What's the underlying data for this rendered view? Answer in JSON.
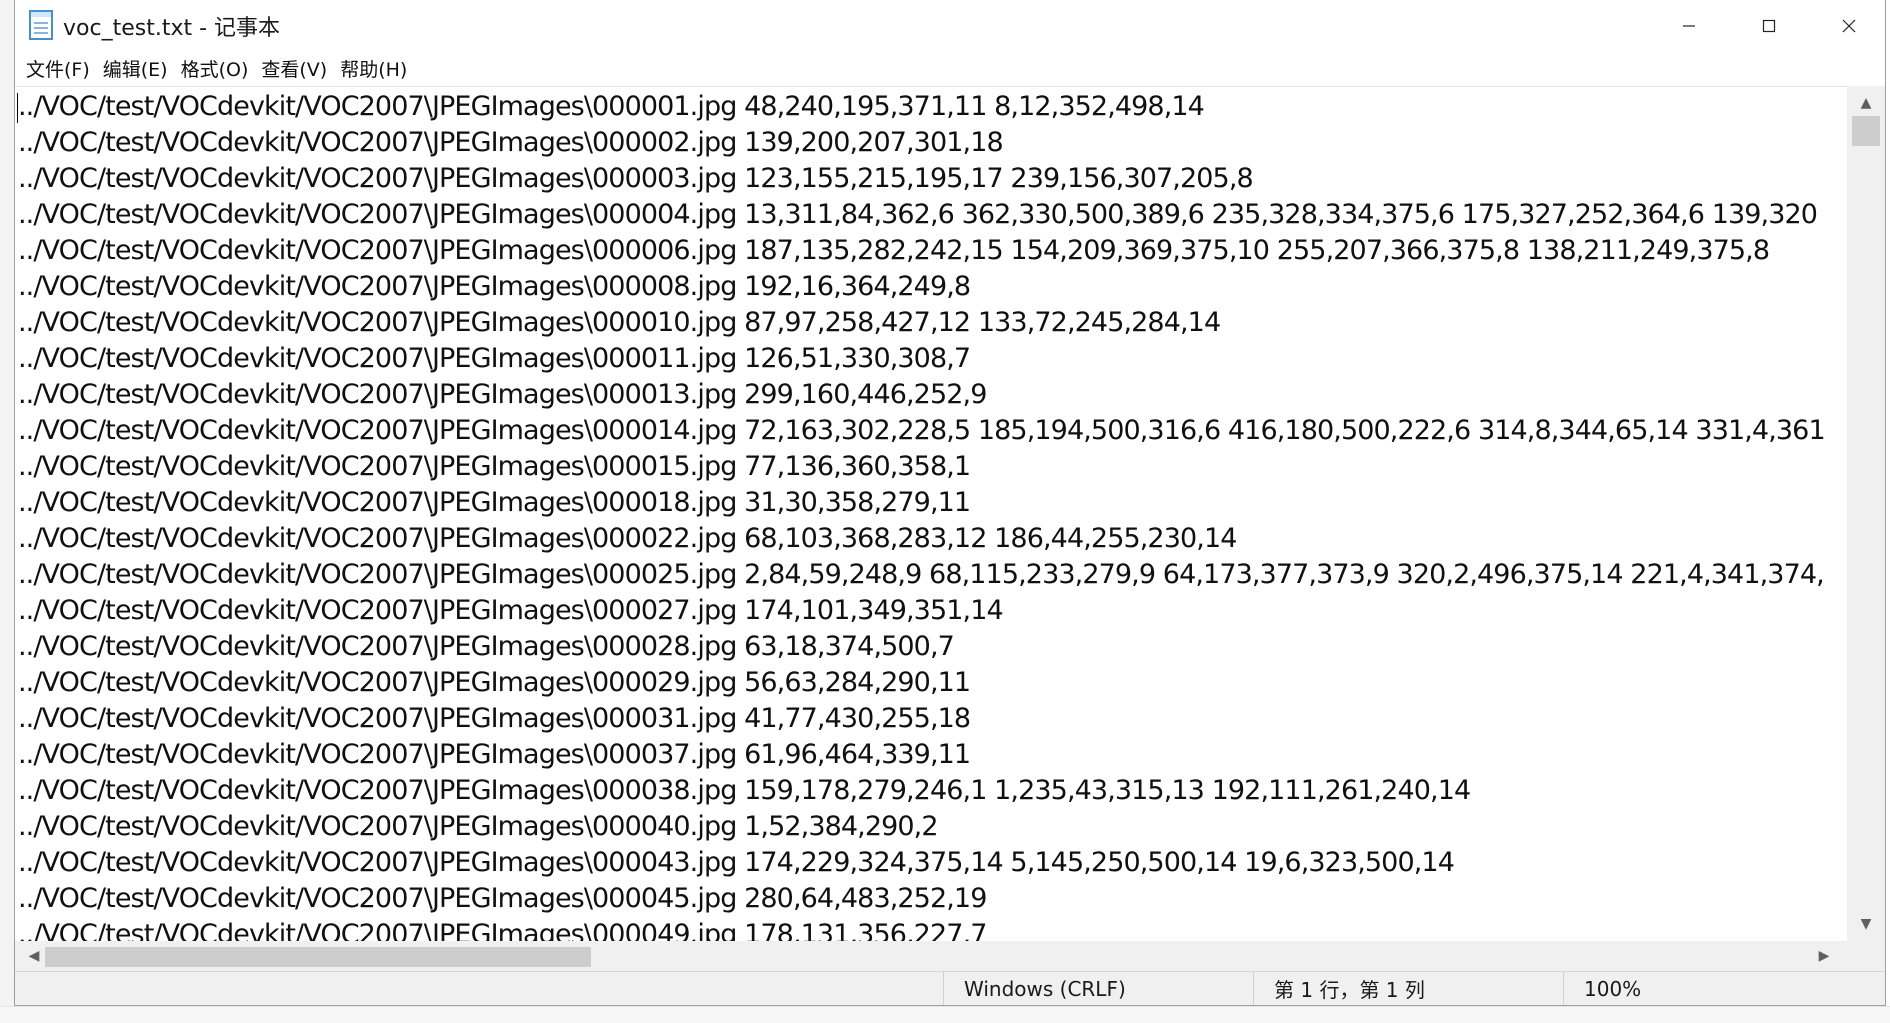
{
  "window": {
    "title": "voc_test.txt - 记事本",
    "controls": {
      "minimize": "minimize-icon",
      "maximize": "maximize-icon",
      "close": "close-icon"
    }
  },
  "menu": {
    "items": [
      {
        "label": "文件(F)"
      },
      {
        "label": "编辑(E)"
      },
      {
        "label": "格式(O)"
      },
      {
        "label": "查看(V)"
      },
      {
        "label": "帮助(H)"
      }
    ]
  },
  "editor": {
    "lines": [
      "../VOC/test/VOCdevkit/VOC2007\\JPEGImages\\000001.jpg 48,240,195,371,11 8,12,352,498,14",
      "../VOC/test/VOCdevkit/VOC2007\\JPEGImages\\000002.jpg 139,200,207,301,18",
      "../VOC/test/VOCdevkit/VOC2007\\JPEGImages\\000003.jpg 123,155,215,195,17 239,156,307,205,8",
      "../VOC/test/VOCdevkit/VOC2007\\JPEGImages\\000004.jpg 13,311,84,362,6 362,330,500,389,6 235,328,334,375,6 175,327,252,364,6 139,320",
      "../VOC/test/VOCdevkit/VOC2007\\JPEGImages\\000006.jpg 187,135,282,242,15 154,209,369,375,10 255,207,366,375,8 138,211,249,375,8",
      "../VOC/test/VOCdevkit/VOC2007\\JPEGImages\\000008.jpg 192,16,364,249,8",
      "../VOC/test/VOCdevkit/VOC2007\\JPEGImages\\000010.jpg 87,97,258,427,12 133,72,245,284,14",
      "../VOC/test/VOCdevkit/VOC2007\\JPEGImages\\000011.jpg 126,51,330,308,7",
      "../VOC/test/VOCdevkit/VOC2007\\JPEGImages\\000013.jpg 299,160,446,252,9",
      "../VOC/test/VOCdevkit/VOC2007\\JPEGImages\\000014.jpg 72,163,302,228,5 185,194,500,316,6 416,180,500,222,6 314,8,344,65,14 331,4,361",
      "../VOC/test/VOCdevkit/VOC2007\\JPEGImages\\000015.jpg 77,136,360,358,1",
      "../VOC/test/VOCdevkit/VOC2007\\JPEGImages\\000018.jpg 31,30,358,279,11",
      "../VOC/test/VOCdevkit/VOC2007\\JPEGImages\\000022.jpg 68,103,368,283,12 186,44,255,230,14",
      "../VOC/test/VOCdevkit/VOC2007\\JPEGImages\\000025.jpg 2,84,59,248,9 68,115,233,279,9 64,173,377,373,9 320,2,496,375,14 221,4,341,374,",
      "../VOC/test/VOCdevkit/VOC2007\\JPEGImages\\000027.jpg 174,101,349,351,14",
      "../VOC/test/VOCdevkit/VOC2007\\JPEGImages\\000028.jpg 63,18,374,500,7",
      "../VOC/test/VOCdevkit/VOC2007\\JPEGImages\\000029.jpg 56,63,284,290,11",
      "../VOC/test/VOCdevkit/VOC2007\\JPEGImages\\000031.jpg 41,77,430,255,18",
      "../VOC/test/VOCdevkit/VOC2007\\JPEGImages\\000037.jpg 61,96,464,339,11",
      "../VOC/test/VOCdevkit/VOC2007\\JPEGImages\\000038.jpg 159,178,279,246,1 1,235,43,315,13 192,111,261,240,14",
      "../VOC/test/VOCdevkit/VOC2007\\JPEGImages\\000040.jpg 1,52,384,290,2",
      "../VOC/test/VOCdevkit/VOC2007\\JPEGImages\\000043.jpg 174,229,324,375,14 5,145,250,500,14 19,6,323,500,14",
      "../VOC/test/VOCdevkit/VOC2007\\JPEGImages\\000045.jpg 280,64,483,252,19",
      "../VOC/test/VOCdevkit/VOC2007\\JPEGImages\\000049.jpg 178,131,356,227,7"
    ]
  },
  "scrollbars": {
    "vertical": {
      "up": "chevron-up-icon",
      "down": "chevron-down-icon"
    },
    "horizontal": {
      "left": "chevron-left-icon",
      "right": "chevron-right-icon"
    }
  },
  "status": {
    "line_ending": "Windows (CRLF)",
    "position": "第 1 行，第 1 列",
    "zoom": "100%"
  }
}
